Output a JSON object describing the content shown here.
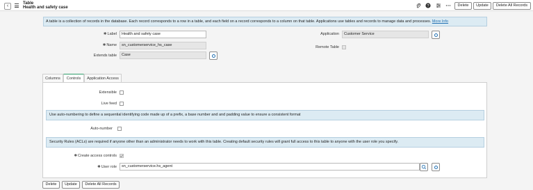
{
  "header": {
    "table_type": "Table",
    "record_name": "Health and safety case",
    "buttons": {
      "delete": "Delete",
      "update": "Update",
      "delete_all": "Delete All Records"
    }
  },
  "info": {
    "text": "A table is a collection of records in the database. Each record corresponds to a row in a table, and each field on a record corresponds to a column on that table. Applications use tables and records to manage data and processes.",
    "link": "More Info"
  },
  "form": {
    "label_label": "Label",
    "label_value": "Health and safety case",
    "name_label": "Name",
    "name_value": "sn_customerservice_hs_case",
    "extends_label": "Extends table",
    "extends_value": "Case",
    "application_label": "Application",
    "application_value": "Customer Service",
    "remote_label": "Remote Table"
  },
  "tabs": [
    "Columns",
    "Controls",
    "Application Access"
  ],
  "controls": {
    "extensible_label": "Extensible",
    "live_feed_label": "Live feed",
    "autonumber_info": "Use auto-numbering to define a sequential identifying code made up of a prefix, a base number and and padding value to ensure a consistent format",
    "autonumber_label": "Auto-number",
    "acl_info": "Security Rules (ACLs) are required if anyone other than an administrator needs to work with this table. Creating default security rules will grant full access to this table to anyone with the user role you specify.",
    "create_access_label": "Create access controls",
    "user_role_label": "User role",
    "user_role_value": "sn_customerservice.hs_agent"
  },
  "footer": {
    "delete": "Delete",
    "update": "Update",
    "delete_all": "Delete All Records"
  },
  "colors": {
    "accent": "#2e9e6a",
    "info_bg": "#dcebf3",
    "link": "#1f6fb2"
  }
}
